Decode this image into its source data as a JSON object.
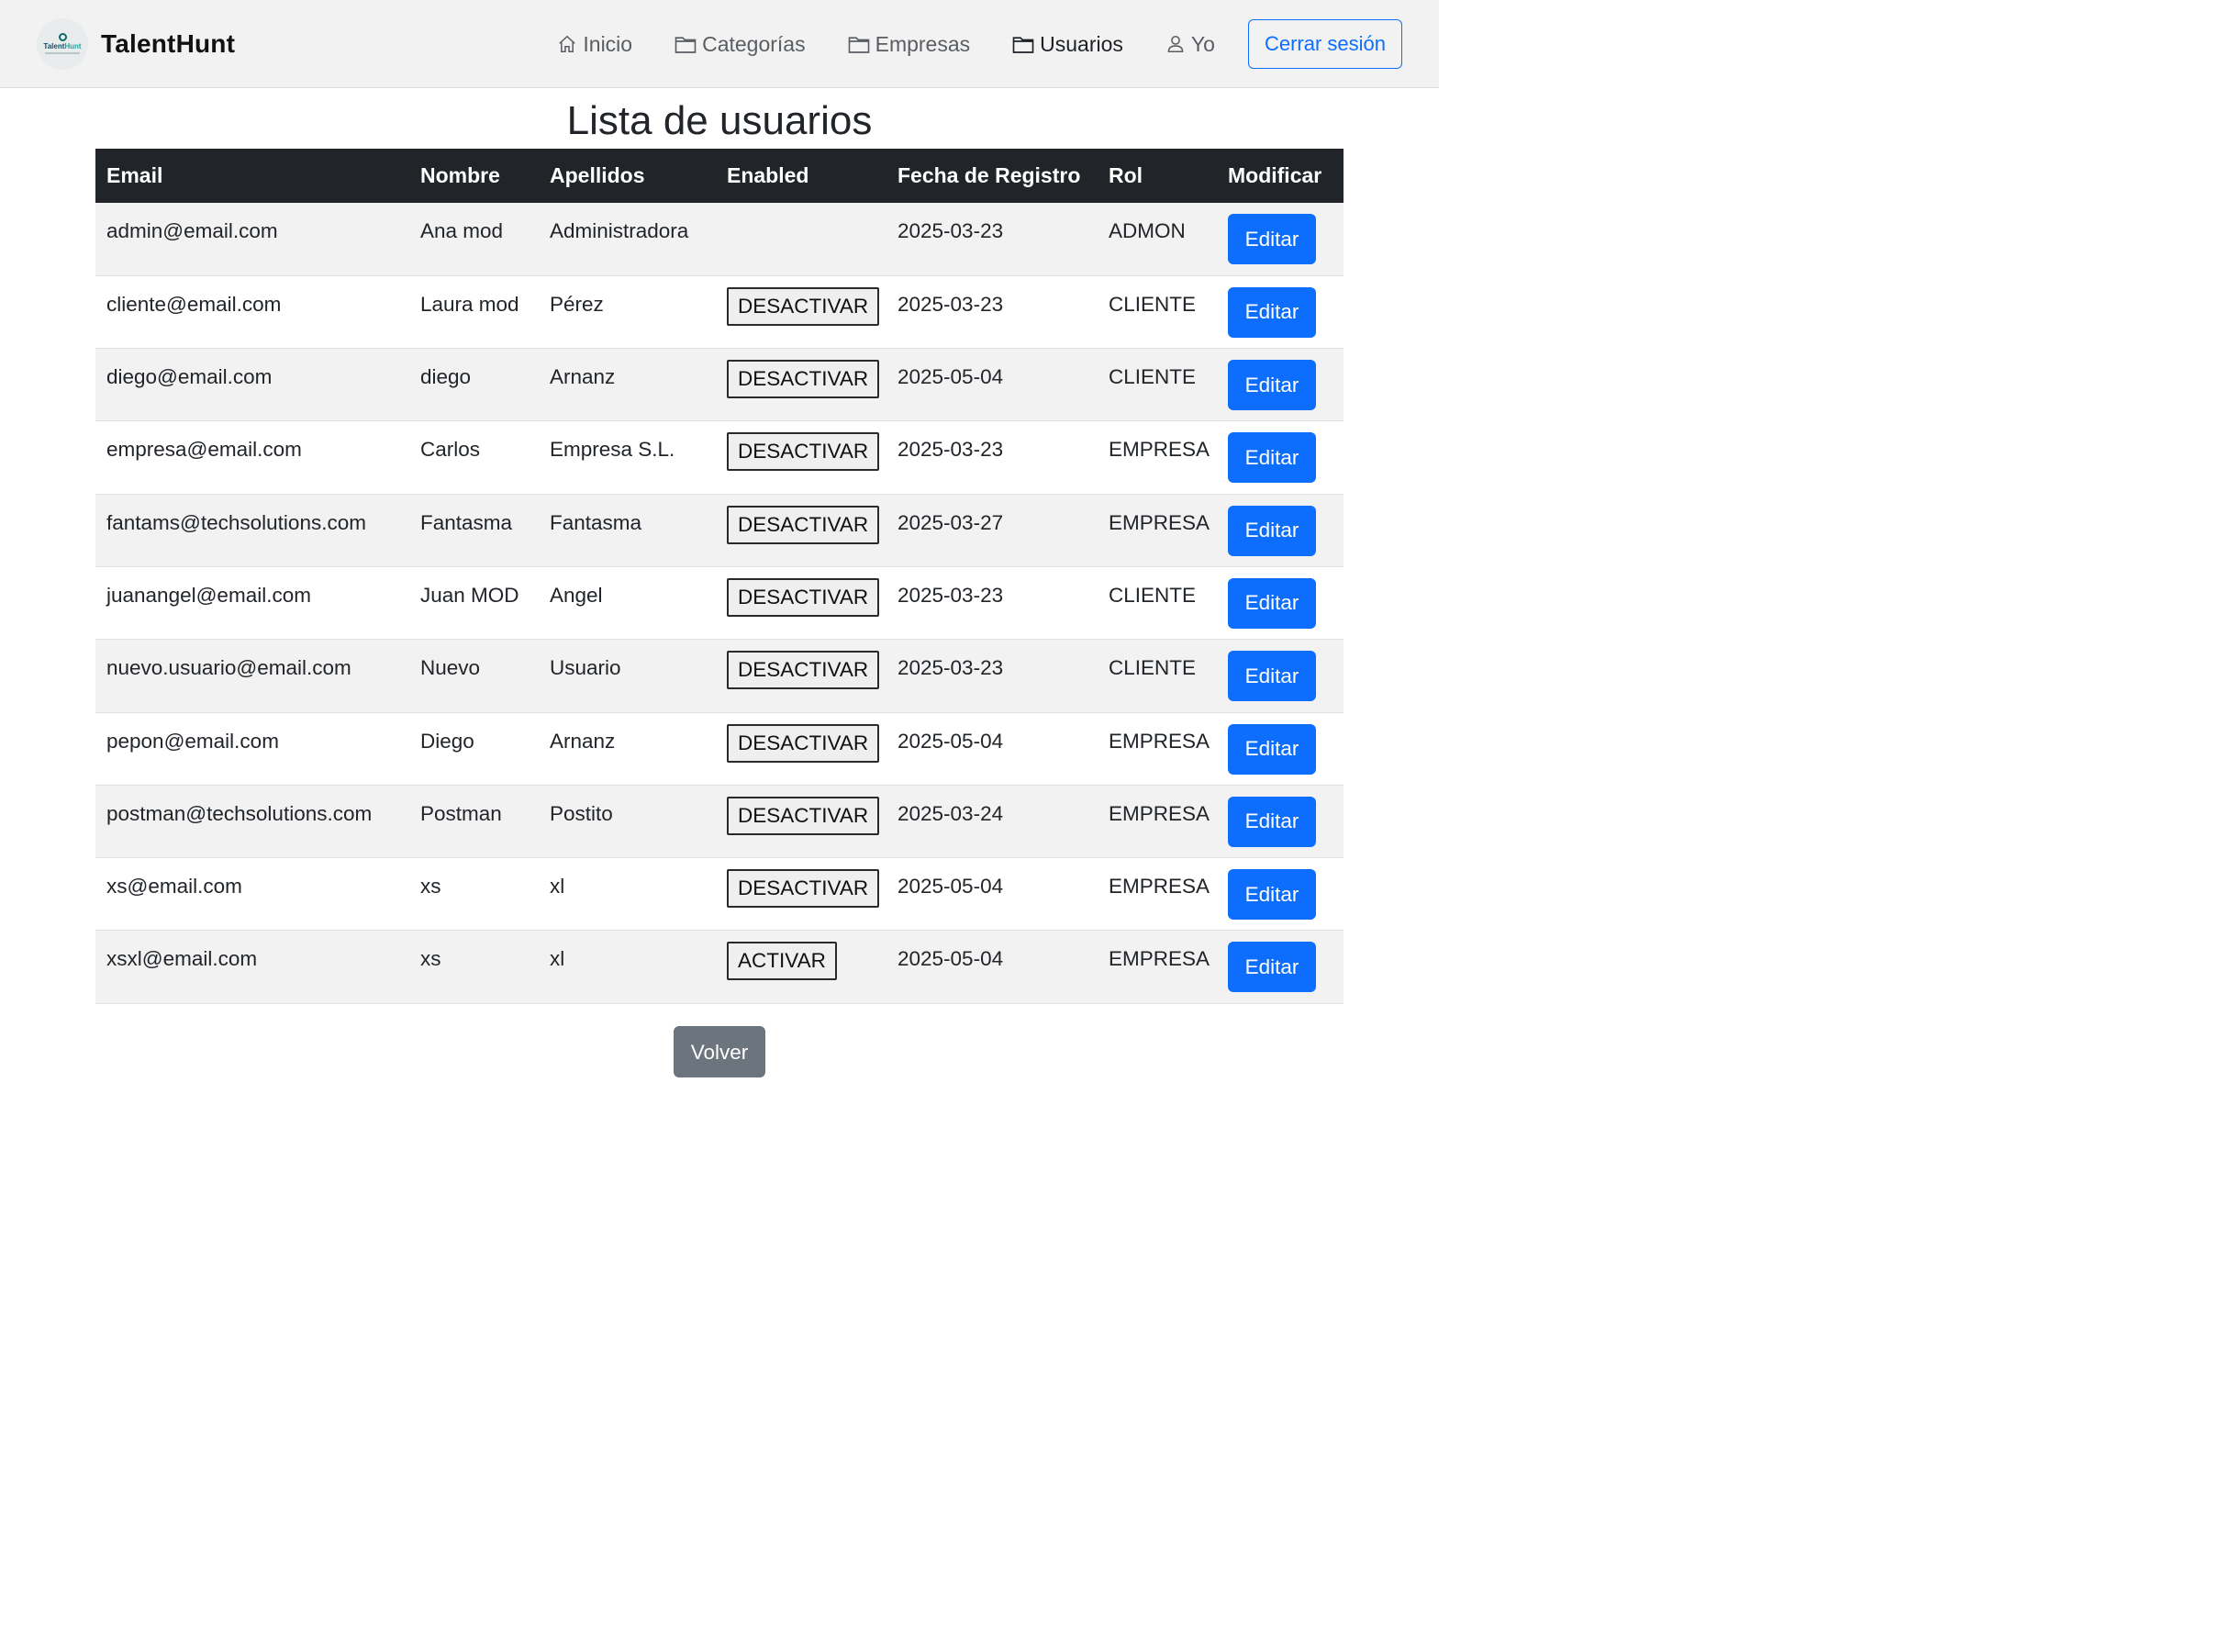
{
  "app": {
    "brand": "TalentHunt",
    "logo_text_a": "Talent",
    "logo_text_b": "Hunt"
  },
  "nav": {
    "items": [
      {
        "label": "Inicio",
        "icon": "house-icon"
      },
      {
        "label": "Categorías",
        "icon": "folder-icon"
      },
      {
        "label": "Empresas",
        "icon": "folder-icon"
      },
      {
        "label": "Usuarios",
        "icon": "folder-icon",
        "active": true
      },
      {
        "label": "Yo",
        "icon": "person-icon"
      }
    ],
    "logout_label": "Cerrar sesión"
  },
  "colors": {
    "primary": "#0d6efd",
    "header_bg": "#212529",
    "secondary": "#6c757d"
  },
  "page": {
    "title": "Lista de usuarios",
    "back_label": "Volver"
  },
  "table": {
    "headers": [
      "Email",
      "Nombre",
      "Apellidos",
      "Enabled",
      "Fecha de Registro",
      "Rol",
      "Modificar"
    ],
    "edit_label": "Editar",
    "rows": [
      {
        "email": "admin@email.com",
        "nombre": "Ana mod",
        "apellidos": "Administradora",
        "enabled": "",
        "fecha": "2025-03-23",
        "rol": "ADMON"
      },
      {
        "email": "cliente@email.com",
        "nombre": "Laura mod",
        "apellidos": "Pérez",
        "enabled": "DESACTIVAR",
        "fecha": "2025-03-23",
        "rol": "CLIENTE"
      },
      {
        "email": "diego@email.com",
        "nombre": "diego",
        "apellidos": "Arnanz",
        "enabled": "DESACTIVAR",
        "fecha": "2025-05-04",
        "rol": "CLIENTE"
      },
      {
        "email": "empresa@email.com",
        "nombre": "Carlos",
        "apellidos": "Empresa S.L.",
        "enabled": "DESACTIVAR",
        "fecha": "2025-03-23",
        "rol": "EMPRESA"
      },
      {
        "email": "fantams@techsolutions.com",
        "nombre": "Fantasma",
        "apellidos": "Fantasma",
        "enabled": "DESACTIVAR",
        "fecha": "2025-03-27",
        "rol": "EMPRESA"
      },
      {
        "email": "juanangel@email.com",
        "nombre": "Juan MOD",
        "apellidos": "Angel",
        "enabled": "DESACTIVAR",
        "fecha": "2025-03-23",
        "rol": "CLIENTE"
      },
      {
        "email": "nuevo.usuario@email.com",
        "nombre": "Nuevo",
        "apellidos": "Usuario",
        "enabled": "DESACTIVAR",
        "fecha": "2025-03-23",
        "rol": "CLIENTE"
      },
      {
        "email": "pepon@email.com",
        "nombre": "Diego",
        "apellidos": "Arnanz",
        "enabled": "DESACTIVAR",
        "fecha": "2025-05-04",
        "rol": "EMPRESA"
      },
      {
        "email": "postman@techsolutions.com",
        "nombre": "Postman",
        "apellidos": "Postito",
        "enabled": "DESACTIVAR",
        "fecha": "2025-03-24",
        "rol": "EMPRESA"
      },
      {
        "email": "xs@email.com",
        "nombre": "xs",
        "apellidos": "xl",
        "enabled": "DESACTIVAR",
        "fecha": "2025-05-04",
        "rol": "EMPRESA"
      },
      {
        "email": "xsxl@email.com",
        "nombre": "xs",
        "apellidos": "xl",
        "enabled": "ACTIVAR",
        "fecha": "2025-05-04",
        "rol": "EMPRESA"
      }
    ]
  }
}
